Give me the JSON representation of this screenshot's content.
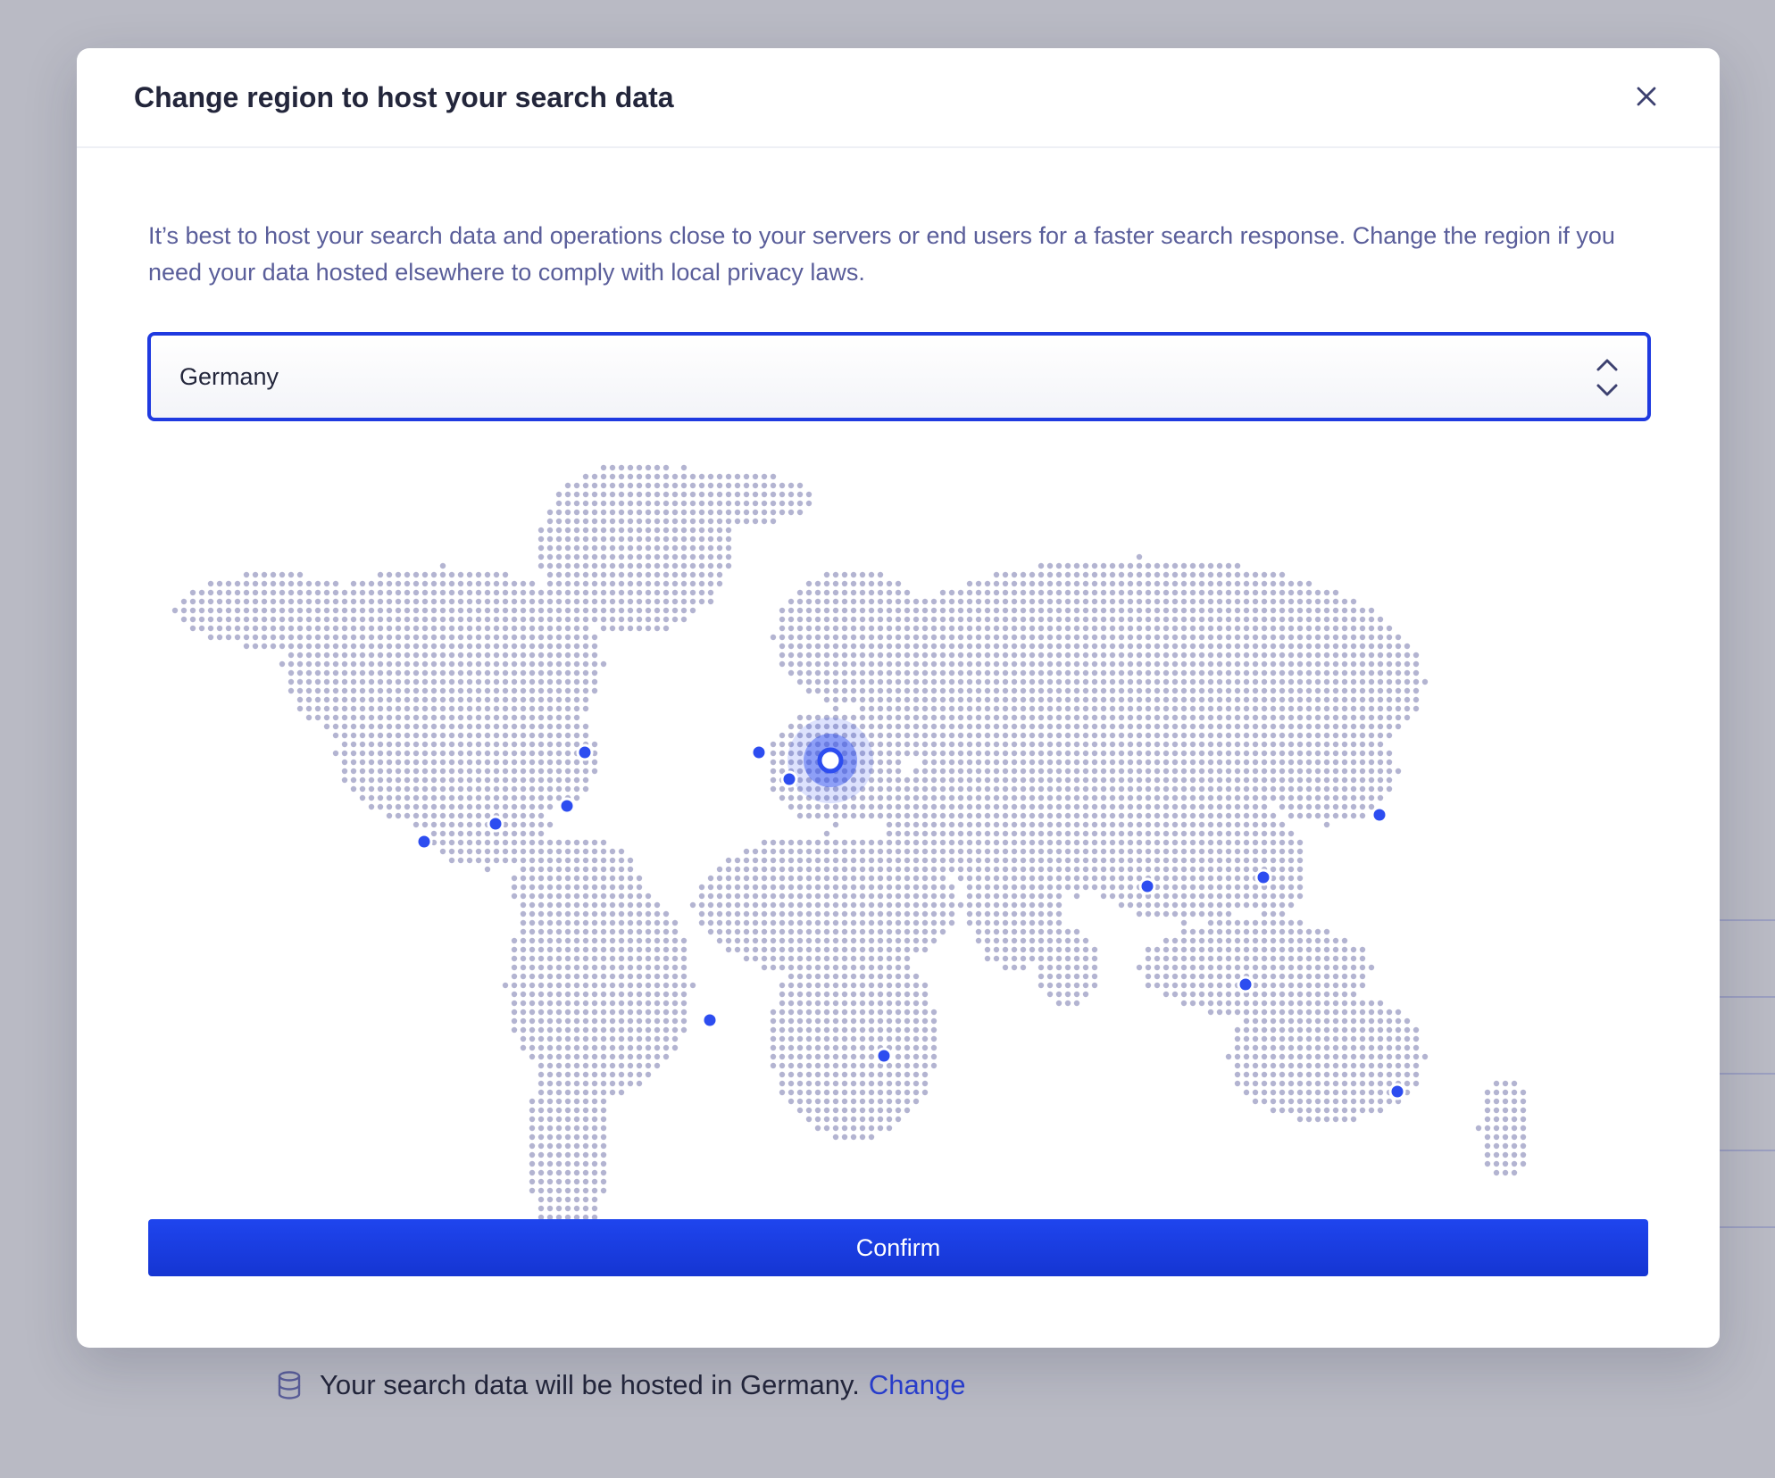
{
  "modal": {
    "title": "Change region to host your search data",
    "description": "It’s best to host your search data and operations close to your servers or end users for a faster search response. Change the region if you need your data hosted elsewhere to comply with local privacy laws.",
    "selected_region": "Germany",
    "confirm_label": "Confirm"
  },
  "footer": {
    "hosting_text": "Your search data will be hosted in Germany.",
    "change_link": "Change"
  },
  "map": {
    "selected_region": "Germany",
    "region_markers": 16
  },
  "colors": {
    "accent": "#1f3ae0",
    "marker": "#2d4df0",
    "land_dots": "#b3b4d1",
    "backdrop": "#b9bac4"
  },
  "icons": {
    "close": "close-icon",
    "select": "chevron-up-down-icon",
    "footer": "database-icon"
  }
}
